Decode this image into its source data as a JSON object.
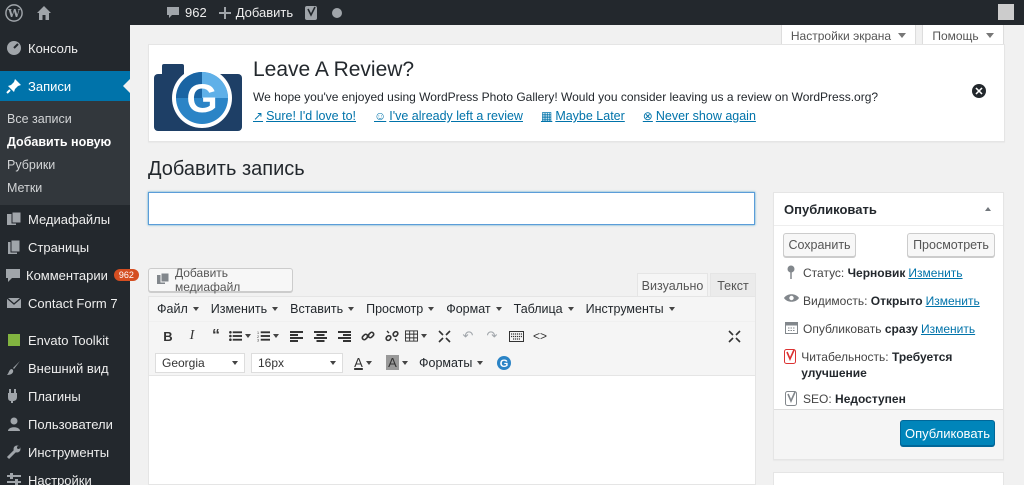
{
  "adminbar": {
    "comments_count": "962",
    "add_new": "Добавить"
  },
  "sidebar": {
    "items": [
      {
        "label": "Консоль",
        "icon": "dashboard-icon"
      },
      {
        "label": "Записи",
        "icon": "pin-icon"
      },
      {
        "label": "Медиафайлы",
        "icon": "media-icon"
      },
      {
        "label": "Страницы",
        "icon": "pages-icon"
      },
      {
        "label": "Комментарии",
        "icon": "comments-icon",
        "badge": "962"
      },
      {
        "label": "Contact Form 7",
        "icon": "mail-icon"
      },
      {
        "label": "Envato Toolkit",
        "icon": "envato-icon"
      },
      {
        "label": "Внешний вид",
        "icon": "brush-icon"
      },
      {
        "label": "Плагины",
        "icon": "plugin-icon"
      },
      {
        "label": "Пользователи",
        "icon": "users-icon"
      },
      {
        "label": "Инструменты",
        "icon": "wrench-icon"
      },
      {
        "label": "Настройки",
        "icon": "settings-icon"
      }
    ],
    "submenu": [
      {
        "label": "Все записи"
      },
      {
        "label": "Добавить новую"
      },
      {
        "label": "Рубрики"
      },
      {
        "label": "Метки"
      }
    ]
  },
  "screen_options": {
    "screen": "Настройки экрана",
    "help": "Помощь"
  },
  "notice": {
    "title": "Leave A Review?",
    "text": "We hope you've enjoyed using WordPress Photo Gallery! Would you consider leaving us a review on WordPress.org?",
    "links": [
      "Sure! I'd love to!",
      "I've already left a review",
      "Maybe Later",
      "Never show again"
    ]
  },
  "page_title": "Добавить запись",
  "title_input": {
    "value": ""
  },
  "media_button": "Добавить медиафайл",
  "editor_tabs": {
    "visual": "Визуально",
    "text": "Текст"
  },
  "menubar": [
    "Файл",
    "Изменить",
    "Вставить",
    "Просмотр",
    "Формат",
    "Таблица",
    "Инструменты"
  ],
  "toolbar2": {
    "font_family": "Georgia",
    "font_size": "16px",
    "formats": "Форматы"
  },
  "publish": {
    "title": "Опубликовать",
    "save": "Сохранить",
    "preview": "Просмотреть",
    "status_label": "Статус:",
    "status_value": "Черновик",
    "visibility_label": "Видимость:",
    "visibility_value": "Открыто",
    "schedule_label": "Опубликовать",
    "schedule_value": "сразу",
    "edit": "Изменить",
    "readability_label": "Читабельность:",
    "readability_value": "Требуется улучшение",
    "seo_label": "SEO:",
    "seo_value": "Недоступен",
    "publish_button": "Опубликовать"
  },
  "colors": {
    "accent": "#0073aa",
    "sidebar_bg": "#23282d",
    "publish_btn": "#0085ba",
    "badge": "#d54e21"
  }
}
